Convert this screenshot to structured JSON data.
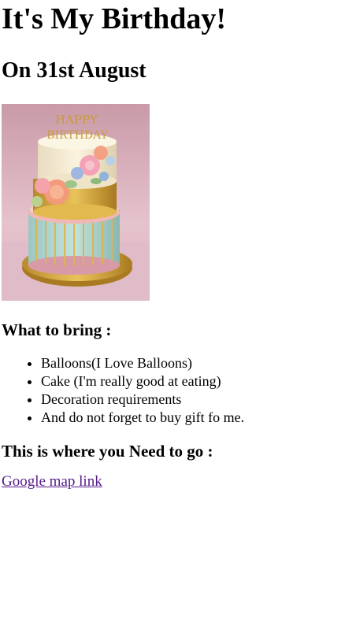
{
  "title": "It's My Birthday!",
  "date": "On 31st August",
  "image": {
    "topper_text_line1": "HAPPY",
    "topper_text_line2": "BIRTHDAY"
  },
  "bring": {
    "heading": "What to bring :",
    "items": [
      "Balloons(I Love Balloons)",
      "Cake (I'm really good at eating)",
      "Decoration requirements",
      "And do not forget to buy gift fo me."
    ]
  },
  "location": {
    "heading": "This is where you Need to go :",
    "link_text": "Google map link"
  },
  "colors": {
    "link_visited": "#551a8b",
    "text": "#000000",
    "background": "#ffffff"
  }
}
